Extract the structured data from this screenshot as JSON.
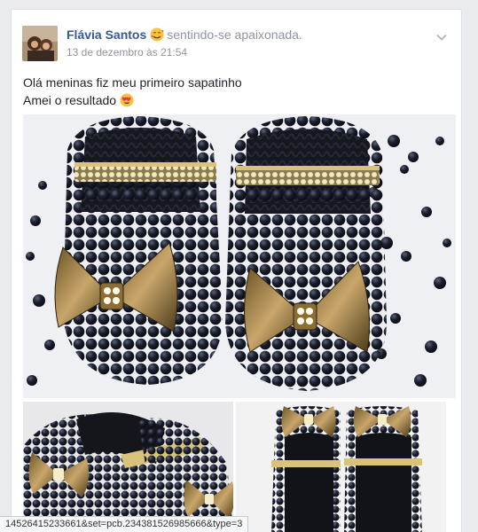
{
  "post": {
    "author": "Flávia Santos",
    "feeling": "sentindo-se apaixonada.",
    "feeling_icon": "smiling-hearts-emoji-icon",
    "timestamp": "13 de dezembro às 21:54",
    "menu_icon": "chevron-down-icon",
    "text_line1": "Olá meninas fiz meu primeiro sapatinho",
    "text_line2": "Amei o resultado",
    "text_emoji": "heart-eyes-emoji-icon"
  },
  "photos": {
    "main": "photo of navy beaded baby shoes with bronze bows",
    "thumbs": [
      "side view of beaded baby shoes",
      "top view of beaded baby shoes"
    ]
  },
  "status_bar": {
    "url": "14526415233661&set=pcb.234381526985666&type=3"
  },
  "colors": {
    "author_link": "#365899",
    "meta_gray": "#90949c",
    "feed_bg": "#e9ebee"
  }
}
